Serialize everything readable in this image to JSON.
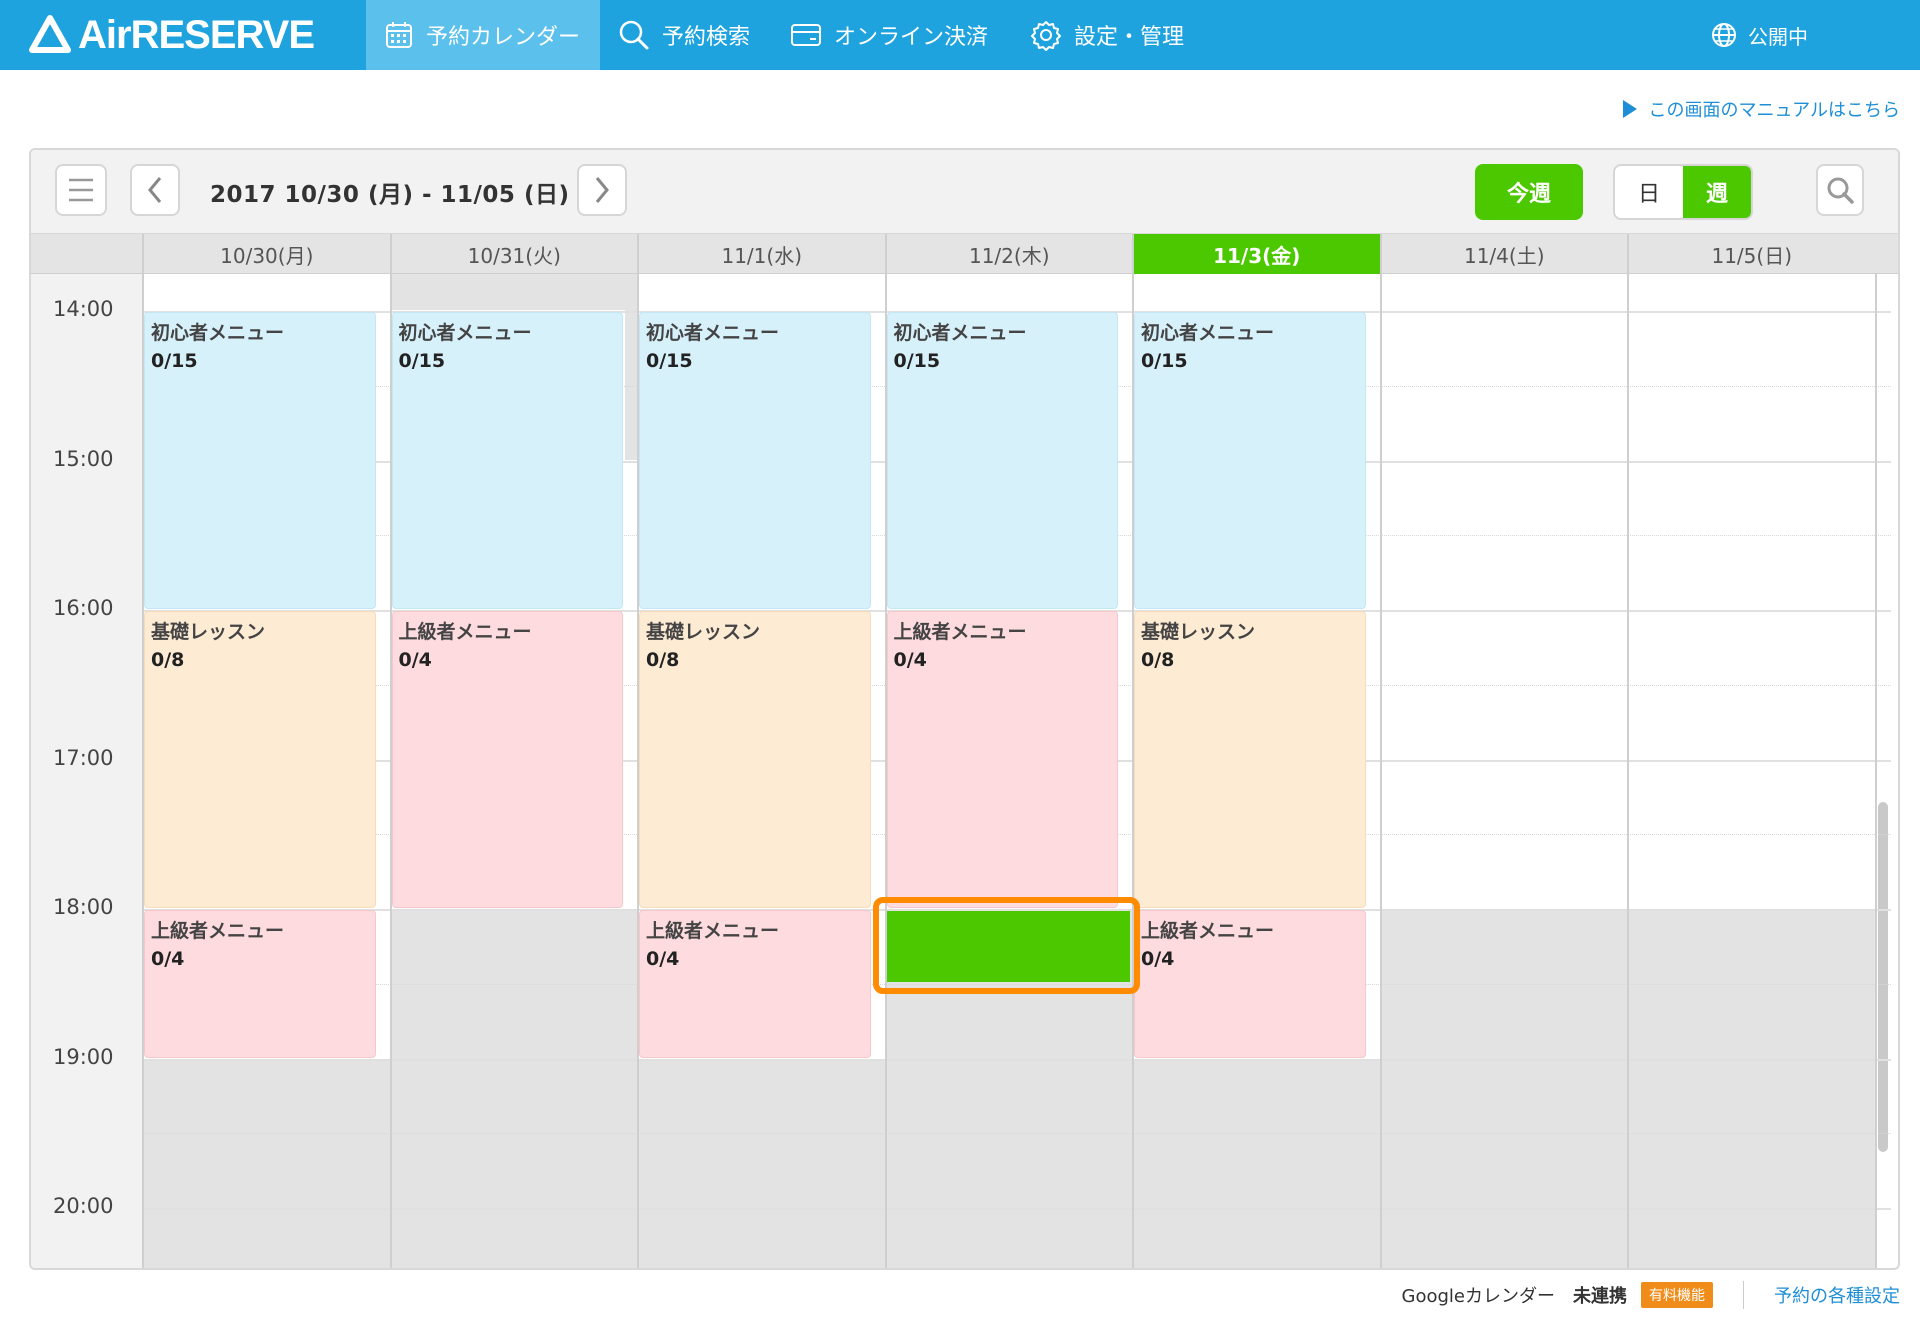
{
  "app": {
    "logo_text": "AirRESERVE"
  },
  "nav": {
    "items": [
      {
        "label": "予約カレンダー",
        "icon": "calendar-icon",
        "active": true
      },
      {
        "label": "予約検索",
        "icon": "search-icon",
        "active": false
      },
      {
        "label": "オンライン決済",
        "icon": "card-icon",
        "active": false
      },
      {
        "label": "設定・管理",
        "icon": "gear-icon",
        "active": false
      }
    ],
    "status_label": "公開中",
    "status_icon": "globe-icon"
  },
  "manual_link": "この画面のマニュアルはこちら",
  "toolbar": {
    "date_range": "2017 10/30 (月) - 11/05 (日)",
    "this_week": "今週",
    "view_day": "日",
    "view_week": "週",
    "menu_icon": "menu-icon",
    "prev_icon": "chevron-left-icon",
    "next_icon": "chevron-right-icon",
    "search_icon": "search-icon"
  },
  "days": [
    "10/30(月)",
    "10/31(火)",
    "11/1(水)",
    "11/2(木)",
    "11/3(金)",
    "11/4(土)",
    "11/5(日)"
  ],
  "today_index": 4,
  "times": [
    "14:00",
    "15:00",
    "16:00",
    "17:00",
    "18:00",
    "19:00",
    "20:00"
  ],
  "events": [
    {
      "day": 0,
      "start": "14:00",
      "end": "16:00",
      "name": "初心者メニュー",
      "count": "0/15",
      "color": "blue"
    },
    {
      "day": 1,
      "start": "14:00",
      "end": "16:00",
      "name": "初心者メニュー",
      "count": "0/15",
      "color": "blue"
    },
    {
      "day": 2,
      "start": "14:00",
      "end": "16:00",
      "name": "初心者メニュー",
      "count": "0/15",
      "color": "blue"
    },
    {
      "day": 3,
      "start": "14:00",
      "end": "16:00",
      "name": "初心者メニュー",
      "count": "0/15",
      "color": "blue"
    },
    {
      "day": 4,
      "start": "14:00",
      "end": "16:00",
      "name": "初心者メニュー",
      "count": "0/15",
      "color": "blue"
    },
    {
      "day": 0,
      "start": "16:00",
      "end": "18:00",
      "name": "基礎レッスン",
      "count": "0/8",
      "color": "orange"
    },
    {
      "day": 1,
      "start": "16:00",
      "end": "18:00",
      "name": "上級者メニュー",
      "count": "0/4",
      "color": "pink"
    },
    {
      "day": 2,
      "start": "16:00",
      "end": "18:00",
      "name": "基礎レッスン",
      "count": "0/8",
      "color": "orange"
    },
    {
      "day": 3,
      "start": "16:00",
      "end": "18:00",
      "name": "上級者メニュー",
      "count": "0/4",
      "color": "pink"
    },
    {
      "day": 4,
      "start": "16:00",
      "end": "18:00",
      "name": "基礎レッスン",
      "count": "0/8",
      "color": "orange"
    },
    {
      "day": 0,
      "start": "18:00",
      "end": "19:00",
      "name": "上級者メニュー",
      "count": "0/4",
      "color": "pink"
    },
    {
      "day": 2,
      "start": "18:00",
      "end": "19:00",
      "name": "上級者メニュー",
      "count": "0/4",
      "color": "pink"
    },
    {
      "day": 4,
      "start": "18:00",
      "end": "19:00",
      "name": "上級者メニュー",
      "count": "0/4",
      "color": "pink"
    }
  ],
  "selected_slot": {
    "day": 3,
    "start": "18:00",
    "end": "18:30"
  },
  "colors": {
    "nav_bg": "#1ea3df",
    "accent_green": "#4cc800",
    "highlight_orange": "#ff8c00",
    "event_blue": "#d7f1fb",
    "event_orange": "#feebd4",
    "event_pink": "#fddbde"
  },
  "footer": {
    "google_label": "Googleカレンダー",
    "google_status": "未連携",
    "paid_badge": "有料機能",
    "settings_link": "予約の各種設定"
  }
}
